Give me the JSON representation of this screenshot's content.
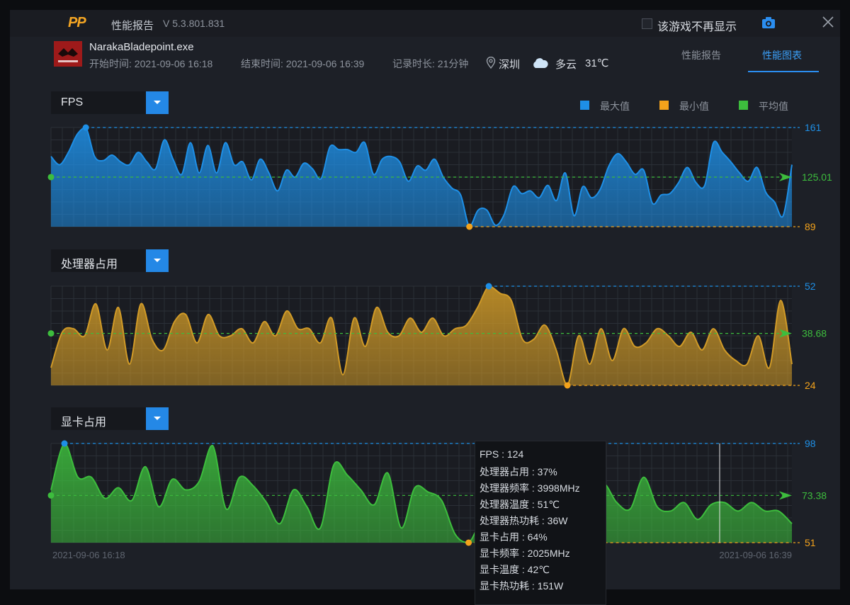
{
  "titlebar": {
    "logo": "PP",
    "app_title": "性能报告",
    "version": "V 5.3.801.831",
    "hide_checkbox_label": "该游戏不再显示",
    "camera_icon": "camera-icon",
    "close_icon": "close-icon"
  },
  "session": {
    "exe": "NarakaBladepoint.exe",
    "start": "开始时间: 2021-09-06 16:18",
    "end": "结束时间: 2021-09-06 16:39",
    "duration": "记录时长: 21分钟",
    "location": "深圳",
    "weather": "多云",
    "temperature": "31℃"
  },
  "tabs": [
    {
      "label": "性能报告",
      "active": false
    },
    {
      "label": "性能图表",
      "active": true
    }
  ],
  "legend": [
    {
      "label": "最大值",
      "color": "#1e8fe6"
    },
    {
      "label": "最小值",
      "color": "#f3a21b"
    },
    {
      "label": "平均值",
      "color": "#3dbd3d"
    }
  ],
  "axis_time": {
    "start": "2021-09-06 16:18",
    "end": "2021-09-06 16:39"
  },
  "tooltip": [
    "FPS : 124",
    "处理器占用 : 37%",
    "处理器频率 : 3998MHz",
    "处理器温度 : 51℃",
    "处理器热功耗 : 36W",
    "显卡占用 : 64%",
    "显卡频率 : 2025MHz",
    "显卡温度 : 42℃",
    "显卡热功耗 : 151W"
  ],
  "chart_data": [
    {
      "type": "area",
      "title": "FPS",
      "color": "#1e8fe6",
      "max": "161",
      "avg": "125.01",
      "min": "89",
      "ylim": [
        89,
        161
      ],
      "values": [
        140,
        134,
        143,
        156,
        161,
        140,
        137,
        141,
        136,
        134,
        143,
        136,
        131,
        152,
        138,
        127,
        150,
        128,
        148,
        128,
        150,
        134,
        136,
        123,
        138,
        128,
        115,
        130,
        125,
        135,
        131,
        124,
        147,
        145,
        145,
        143,
        150,
        127,
        138,
        140,
        136,
        122,
        133,
        130,
        138,
        125,
        117,
        112,
        89,
        101,
        101,
        90,
        98,
        118,
        113,
        115,
        110,
        119,
        108,
        128,
        97,
        118,
        110,
        116,
        133,
        142,
        136,
        127,
        130,
        106,
        112,
        113,
        121,
        132,
        121,
        119,
        150,
        143,
        136,
        128,
        122,
        132,
        114,
        107,
        97,
        134
      ]
    },
    {
      "type": "area",
      "title": "处理器占用",
      "color": "#d09a27",
      "max": "52",
      "avg": "38.68",
      "min": "24",
      "ylim": [
        24,
        52
      ],
      "values": [
        29,
        39,
        40,
        38,
        47,
        34,
        46,
        30,
        47,
        37,
        34,
        42,
        44,
        36,
        44,
        38,
        38,
        40,
        36,
        42,
        38,
        45,
        40,
        40,
        36,
        43,
        27,
        43,
        35,
        46,
        39,
        38,
        43,
        39,
        43,
        38,
        40,
        41,
        46,
        52,
        50,
        48,
        37,
        37,
        41,
        34,
        24,
        38,
        30,
        40,
        31,
        40,
        35,
        36,
        40,
        38,
        35,
        39,
        34,
        40,
        34,
        31,
        30,
        38,
        29,
        48,
        30
      ]
    },
    {
      "type": "area",
      "title": "显卡占用",
      "color": "#3dbd3d",
      "max": "98",
      "avg": "73.38",
      "min": "51",
      "ylim": [
        51,
        98
      ],
      "values": [
        76,
        98,
        82,
        82,
        72,
        77,
        71,
        87,
        68,
        81,
        76,
        80,
        97,
        67,
        82,
        78,
        70,
        60,
        76,
        68,
        58,
        88,
        83,
        76,
        69,
        84,
        58,
        77,
        75,
        71,
        55,
        51,
        62,
        65,
        66,
        61,
        71,
        65,
        68,
        60,
        70,
        79,
        70,
        67,
        82,
        68,
        66,
        70,
        62,
        69,
        70,
        66,
        70,
        66,
        66,
        60
      ]
    }
  ]
}
